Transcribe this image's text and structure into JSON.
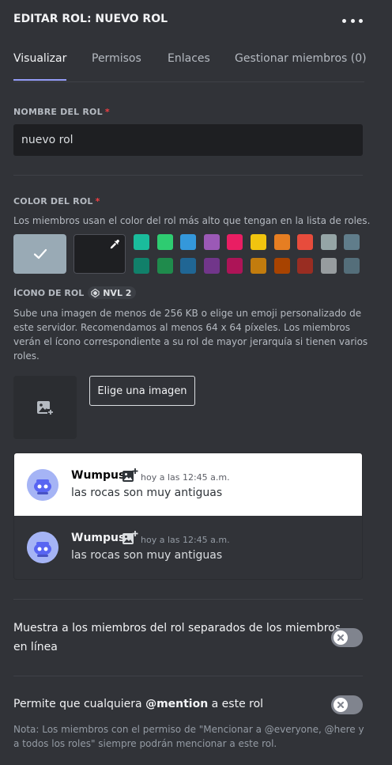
{
  "header": {
    "title": "EDITAR ROL: NUEVO ROL",
    "more_icon": "more-dots-icon"
  },
  "tabs": [
    {
      "label": "Visualizar",
      "active": true
    },
    {
      "label": "Permisos",
      "active": false
    },
    {
      "label": "Enlaces",
      "active": false
    },
    {
      "label": "Gestionar miembros (0)",
      "active": false
    }
  ],
  "role_name": {
    "label": "NOMBRE DEL ROL",
    "required": "*",
    "value": "nuevo rol"
  },
  "role_color": {
    "label": "COLOR DEL ROL",
    "required": "*",
    "description": "Los miembros usan el color del rol más alto que tengan en la lista de roles.",
    "default_color": "#99aab5",
    "selected": "default",
    "check_icon": "check-icon",
    "picker_icon": "eyedropper-icon",
    "swatches_row1": [
      "#1abc9c",
      "#2ecc71",
      "#3498db",
      "#9b59b6",
      "#e91e63",
      "#f1c40f",
      "#e67e22",
      "#e74c3c",
      "#95a5a6",
      "#607d8b"
    ],
    "swatches_row2": [
      "#11806a",
      "#1f8b4c",
      "#206694",
      "#71368a",
      "#ad1457",
      "#c27c0e",
      "#a84300",
      "#992d22",
      "#979c9f",
      "#546e7a"
    ]
  },
  "role_icon": {
    "label": "ÍCONO DE ROL",
    "badge": "NVL 2",
    "description_lines": [
      "Sube una imagen de menos de 256 KB o elige un emoji personalizado de",
      "este servidor. Recomendamos al menos 64 x 64 píxeles. Los miembros",
      "verán el ícono correspondiente a su rol de mayor jerarquía si tienen varios",
      "roles."
    ],
    "upload_icon": "image-add-icon",
    "choose_button": "Elige una imagen"
  },
  "preview": {
    "messages": [
      {
        "theme": "light",
        "author": "Wumpus",
        "timestamp": "hoy a las 12:45 a.m.",
        "text": "las rocas son muy antiguas"
      },
      {
        "theme": "dark",
        "author": "Wumpus",
        "timestamp": "hoy a las 12:45 a.m.",
        "text": "las rocas son muy antiguas"
      }
    ]
  },
  "settings": {
    "hoist": {
      "line1": "Muestra a los miembros del rol separados de los miembros",
      "line2": "en línea",
      "enabled": false
    },
    "mentionable": {
      "label_prefix": "Permite que cualquiera",
      "label_mention": "@mention",
      "label_suffix": "a este rol",
      "enabled": false,
      "note_line1": "Nota: Los miembros con el permiso de \"Mencionar a @everyone, @here y",
      "note_line2": "a todos los roles\" siempre podrán mencionar a este rol."
    }
  }
}
